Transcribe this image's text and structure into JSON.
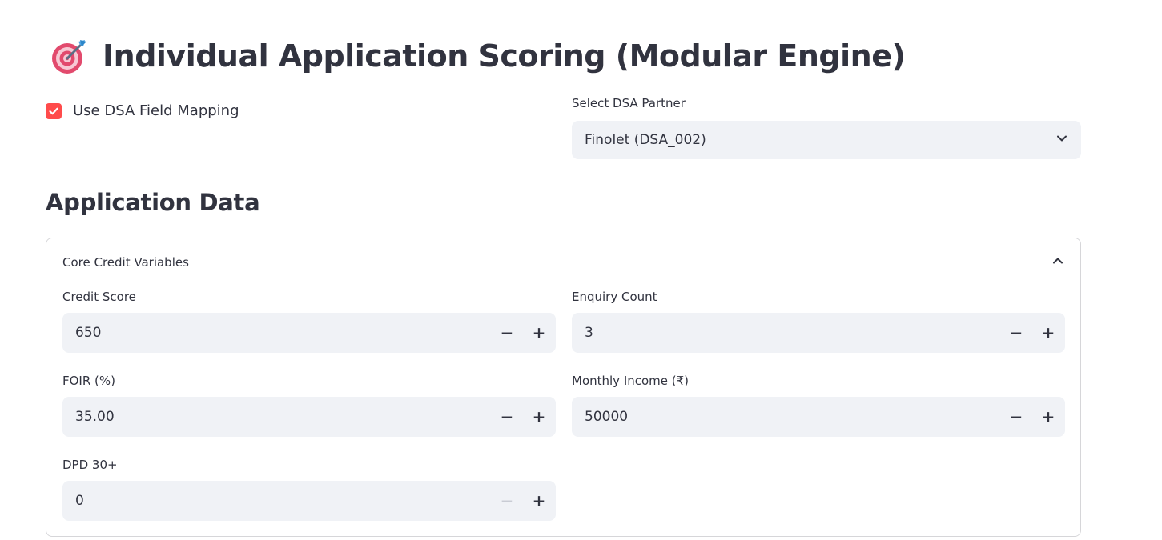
{
  "page": {
    "title": "Individual Application Scoring (Modular Engine)",
    "title_icon": "target-dart-icon"
  },
  "dsa_mapping": {
    "label": "Use DSA Field Mapping",
    "checked": true,
    "accent_color": "#ff4b4b"
  },
  "dsa_partner": {
    "label": "Select DSA Partner",
    "value": "Finolet (DSA_002)",
    "icon": "chevron-down-icon"
  },
  "section": {
    "heading": "Application Data"
  },
  "expander": {
    "title": "Core Credit Variables",
    "expanded": true,
    "icon": "chevron-up-icon"
  },
  "fields": {
    "credit_score": {
      "label": "Credit Score",
      "value": "650"
    },
    "enquiry_count": {
      "label": "Enquiry Count",
      "value": "3"
    },
    "foir": {
      "label": "FOIR (%)",
      "value": "35.00"
    },
    "monthly_income": {
      "label": "Monthly Income (₹)",
      "value": "50000"
    },
    "dpd_30": {
      "label": "DPD 30+",
      "value": "0"
    }
  },
  "stepper": {
    "minus": "−",
    "plus": "+"
  }
}
